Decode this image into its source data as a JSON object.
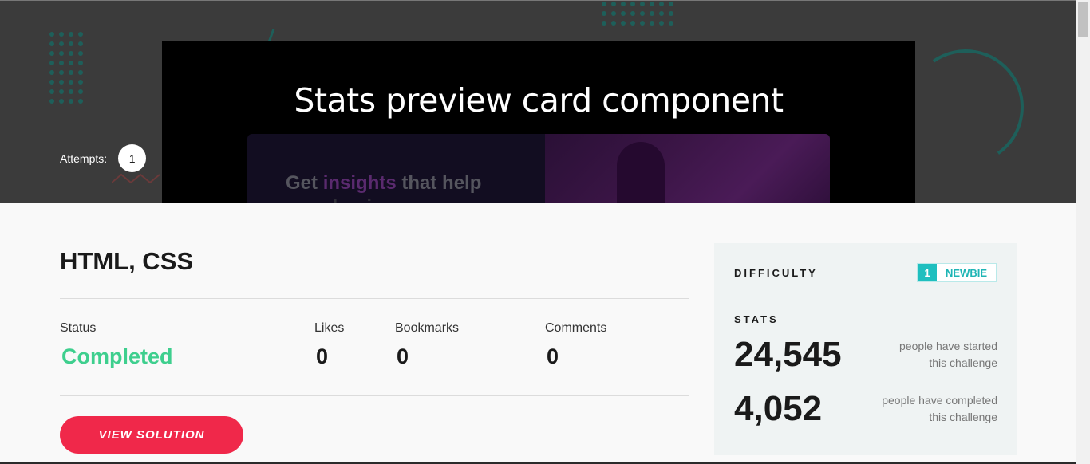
{
  "hero": {
    "title": "Stats preview card component",
    "preview_text_1a": "Get ",
    "preview_text_1b": "insights",
    "preview_text_1c": " that help",
    "preview_text_2": "your business grow",
    "attempts_label": "Attempts:",
    "attempts_count": "1"
  },
  "challenge": {
    "technologies": "HTML, CSS",
    "stats": [
      {
        "label": "Status",
        "value": "Completed"
      },
      {
        "label": "Likes",
        "value": "0"
      },
      {
        "label": "Bookmarks",
        "value": "0"
      },
      {
        "label": "Comments",
        "value": "0"
      }
    ],
    "button_label": "VIEW SOLUTION"
  },
  "sidebar": {
    "difficulty_heading": "DIFFICULTY",
    "difficulty_level": "1",
    "difficulty_label": "NEWBIE",
    "stats_heading": "STATS",
    "started_count": "24,545",
    "started_desc_1": "people have started",
    "started_desc_2": "this challenge",
    "completed_count": "4,052",
    "completed_desc_1": "people have completed",
    "completed_desc_2": "this challenge"
  },
  "colors": {
    "accent": "#f0284a",
    "completed": "#3ecf8e",
    "newbie": "#1fbfbf",
    "hero_bg": "#3b3b3b"
  }
}
